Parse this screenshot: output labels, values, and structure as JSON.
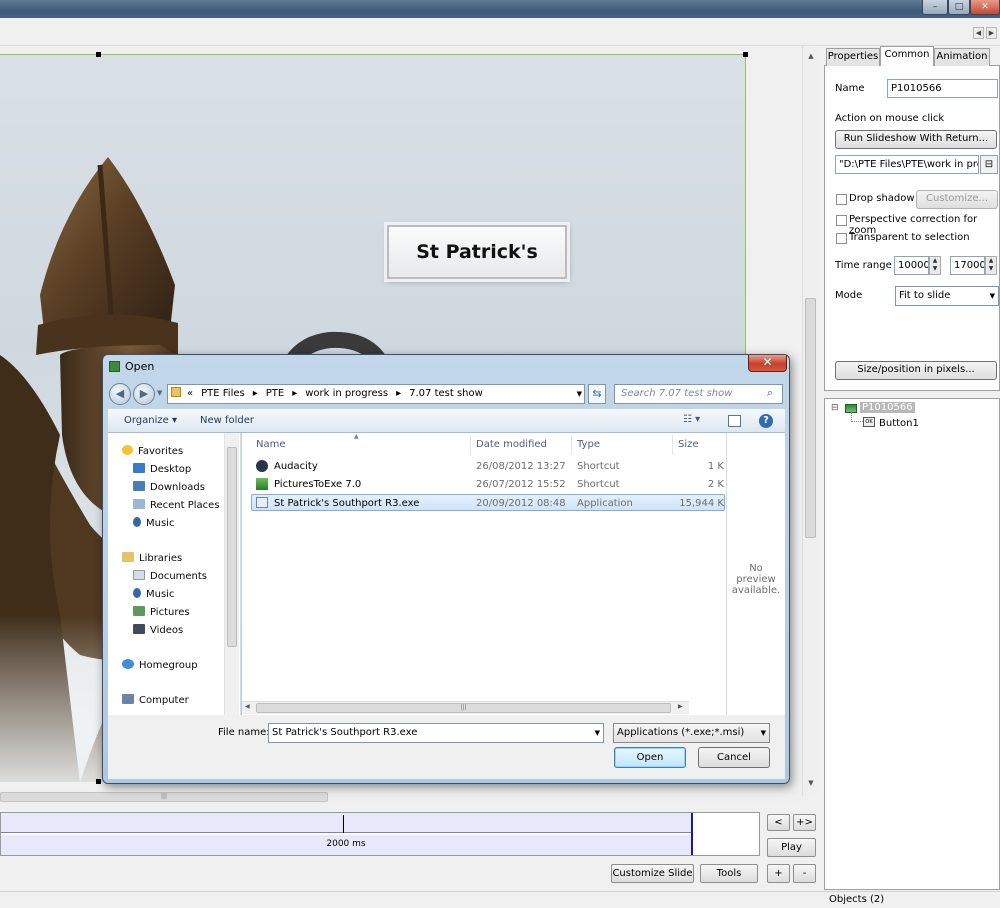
{
  "window": {
    "minimize": "–",
    "maximize": "□",
    "close": "✕"
  },
  "nav_arrows": {
    "left": "◀",
    "right": "▶"
  },
  "slide": {
    "title_text": "St Patrick's"
  },
  "timeline": {
    "duration_text": "2000 ms",
    "prev_label": "<",
    "next_label": "+>",
    "play_label": "Play",
    "customize_slide_label": "Customize Slide",
    "tools_label": "Tools",
    "add_label": "+",
    "remove_label": "-"
  },
  "panel": {
    "tabs": [
      "Properties",
      "Common",
      "Animation"
    ],
    "active_tab": "Common",
    "name_label": "Name",
    "name_value": "P1010566",
    "action_label": "Action on mouse click",
    "action_button": "Run Slideshow With Return...",
    "action_path": "\"D:\\PTE Files\\PTE\\work in progr",
    "drop_shadow_label": "Drop shadow",
    "customize_label": "Customize...",
    "perspective_label": "Perspective correction for zoom",
    "transparent_label": "Transparent to selection",
    "time_range_label": "Time range",
    "time_from": "10000",
    "time_to": "17000",
    "mode_label": "Mode",
    "mode_value": "Fit to slide",
    "size_button": "Size/position in pixels..."
  },
  "tree": {
    "root": "P1010566",
    "child": "Button1",
    "expander": "⊟",
    "child_badge": "OK"
  },
  "status": {
    "objects": "Objects (2)"
  },
  "dialog": {
    "title": "Open",
    "close": "✕",
    "breadcrumb": [
      "«",
      "PTE Files",
      "▸",
      "PTE",
      "▸",
      "work in progress",
      "▸",
      "7.07 test show"
    ],
    "search_placeholder": "Search 7.07 test show",
    "organize_label": "Organize ▾",
    "new_folder_label": "New folder",
    "nav": {
      "favorites": "Favorites",
      "desktop": "Desktop",
      "downloads": "Downloads",
      "recent": "Recent Places",
      "music_fav": "Music",
      "libraries": "Libraries",
      "documents": "Documents",
      "music": "Music",
      "pictures": "Pictures",
      "videos": "Videos",
      "homegroup": "Homegroup",
      "computer": "Computer"
    },
    "columns": {
      "name": "Name",
      "date": "Date modified",
      "type": "Type",
      "size": "Size"
    },
    "files": [
      {
        "name": "Audacity",
        "date": "26/08/2012 13:27",
        "type": "Shortcut",
        "size": "1 K"
      },
      {
        "name": "PicturesToExe 7.0",
        "date": "26/07/2012 15:52",
        "type": "Shortcut",
        "size": "2 K"
      },
      {
        "name": "St Patrick's Southport R3.exe",
        "date": "20/09/2012 08:48",
        "type": "Application",
        "size": "15,944 K"
      }
    ],
    "preview_text": "No preview available.",
    "file_name_label": "File name:",
    "file_name_value": "St Patrick's Southport R3.exe",
    "filter_value": "Applications (*.exe;*.msi)",
    "open_label": "Open",
    "cancel_label": "Cancel"
  }
}
